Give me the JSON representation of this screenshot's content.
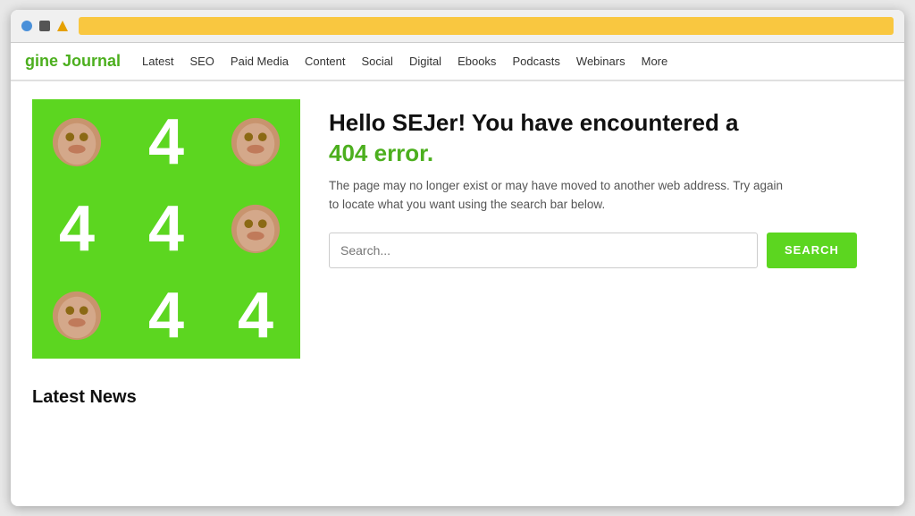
{
  "browser": {
    "address_bar_color": "#f9c740"
  },
  "nav": {
    "logo_prefix": "gine ",
    "logo_highlight": "Journal",
    "links": [
      "Latest",
      "SEO",
      "Paid Media",
      "Content",
      "Social",
      "Digital",
      "Ebooks",
      "Podcasts",
      "Webinars",
      "More"
    ]
  },
  "error_page": {
    "title_line1": "Hello SEJer! You have encountered a",
    "title_line2": "404 error.",
    "description": "The page may no longer exist or may have moved to another web address. Try again to locate what you want using the search bar below.",
    "search_placeholder": "Search...",
    "search_button_label": "SEARCH"
  },
  "latest_news": {
    "section_title": "Latest News"
  },
  "colors": {
    "green": "#5cd620",
    "nav_green": "#4caf1e"
  }
}
